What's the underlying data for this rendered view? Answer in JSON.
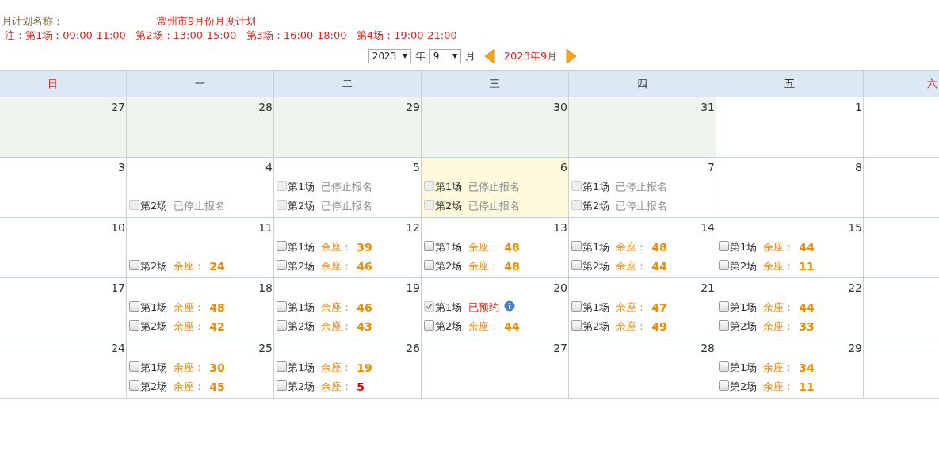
{
  "plan": {
    "label": "月计划名称：",
    "name": "常州市9月份月度计划"
  },
  "note": "注：第1场：09:00-11:00   第2场：13:00-15:00   第3场：16:00-18:00   第4场：19:00-21:00",
  "nav": {
    "year": "2023",
    "year_unit": "年",
    "month": "9",
    "month_unit": "月",
    "current": "2023年9月"
  },
  "weekdays": [
    {
      "label": "日",
      "weekend": true
    },
    {
      "label": "一",
      "weekend": false
    },
    {
      "label": "二",
      "weekend": false
    },
    {
      "label": "三",
      "weekend": false
    },
    {
      "label": "四",
      "weekend": false
    },
    {
      "label": "五",
      "weekend": false
    },
    {
      "label": "六",
      "weekend": true
    }
  ],
  "weeks": [
    [
      {
        "day": "27",
        "kind": "other"
      },
      {
        "day": "28",
        "kind": "other"
      },
      {
        "day": "29",
        "kind": "other"
      },
      {
        "day": "30",
        "kind": "other"
      },
      {
        "day": "31",
        "kind": "other"
      },
      {
        "day": "1",
        "kind": "normal"
      }
    ],
    [
      {
        "day": "3",
        "kind": "normal"
      },
      {
        "day": "4",
        "kind": "normal",
        "sessions": [
          {
            "label": "第2场",
            "kind": "closed",
            "status": "已停止报名",
            "checked": false,
            "disabled": true
          }
        ]
      },
      {
        "day": "5",
        "kind": "normal",
        "sessions": [
          {
            "label": "第1场",
            "kind": "closed",
            "status": "已停止报名",
            "checked": false,
            "disabled": true
          },
          {
            "label": "第2场",
            "kind": "closed",
            "status": "已停止报名",
            "checked": false,
            "disabled": true
          }
        ]
      },
      {
        "day": "6",
        "kind": "today",
        "sessions": [
          {
            "label": "第1场",
            "kind": "closed",
            "status": "已停止报名",
            "checked": false,
            "disabled": true
          },
          {
            "label": "第2场",
            "kind": "closed",
            "status": "已停止报名",
            "checked": false,
            "disabled": true
          }
        ]
      },
      {
        "day": "7",
        "kind": "normal",
        "sessions": [
          {
            "label": "第1场",
            "kind": "closed",
            "status": "已停止报名",
            "checked": false,
            "disabled": true
          },
          {
            "label": "第2场",
            "kind": "closed",
            "status": "已停止报名",
            "checked": false,
            "disabled": true
          }
        ]
      },
      {
        "day": "8",
        "kind": "normal"
      }
    ],
    [
      {
        "day": "10",
        "kind": "normal"
      },
      {
        "day": "11",
        "kind": "normal",
        "sessions": [
          {
            "label": "第2场",
            "kind": "seats",
            "status": "余座：",
            "count": "24",
            "low": false,
            "checked": false,
            "disabled": false
          }
        ]
      },
      {
        "day": "12",
        "kind": "normal",
        "sessions": [
          {
            "label": "第1场",
            "kind": "seats",
            "status": "余座：",
            "count": "39",
            "low": false,
            "checked": false,
            "disabled": false
          },
          {
            "label": "第2场",
            "kind": "seats",
            "status": "余座：",
            "count": "46",
            "low": false,
            "checked": false,
            "disabled": false
          }
        ]
      },
      {
        "day": "13",
        "kind": "normal",
        "sessions": [
          {
            "label": "第1场",
            "kind": "seats",
            "status": "余座：",
            "count": "48",
            "low": false,
            "checked": false,
            "disabled": false
          },
          {
            "label": "第2场",
            "kind": "seats",
            "status": "余座：",
            "count": "48",
            "low": false,
            "checked": false,
            "disabled": false
          }
        ]
      },
      {
        "day": "14",
        "kind": "normal",
        "sessions": [
          {
            "label": "第1场",
            "kind": "seats",
            "status": "余座：",
            "count": "48",
            "low": false,
            "checked": false,
            "disabled": false
          },
          {
            "label": "第2场",
            "kind": "seats",
            "status": "余座：",
            "count": "44",
            "low": false,
            "checked": false,
            "disabled": false
          }
        ]
      },
      {
        "day": "15",
        "kind": "normal",
        "sessions": [
          {
            "label": "第1场",
            "kind": "seats",
            "status": "余座：",
            "count": "44",
            "low": false,
            "checked": false,
            "disabled": false
          },
          {
            "label": "第2场",
            "kind": "seats",
            "status": "余座：",
            "count": "11",
            "low": false,
            "checked": false,
            "disabled": false
          }
        ]
      }
    ],
    [
      {
        "day": "17",
        "kind": "normal"
      },
      {
        "day": "18",
        "kind": "normal",
        "sessions": [
          {
            "label": "第1场",
            "kind": "seats",
            "status": "余座：",
            "count": "48",
            "low": false,
            "checked": false,
            "disabled": false
          },
          {
            "label": "第2场",
            "kind": "seats",
            "status": "余座：",
            "count": "42",
            "low": false,
            "checked": false,
            "disabled": false
          }
        ]
      },
      {
        "day": "19",
        "kind": "normal",
        "sessions": [
          {
            "label": "第1场",
            "kind": "seats",
            "status": "余座：",
            "count": "46",
            "low": false,
            "checked": false,
            "disabled": false
          },
          {
            "label": "第2场",
            "kind": "seats",
            "status": "余座：",
            "count": "43",
            "low": false,
            "checked": false,
            "disabled": false
          }
        ]
      },
      {
        "day": "20",
        "kind": "normal",
        "sessions": [
          {
            "label": "第1场",
            "kind": "booked",
            "status": "已预约",
            "checked": true,
            "disabled": true
          },
          {
            "label": "第2场",
            "kind": "seats",
            "status": "余座：",
            "count": "44",
            "low": false,
            "checked": false,
            "disabled": false
          }
        ]
      },
      {
        "day": "21",
        "kind": "normal",
        "sessions": [
          {
            "label": "第1场",
            "kind": "seats",
            "status": "余座：",
            "count": "47",
            "low": false,
            "checked": false,
            "disabled": false
          },
          {
            "label": "第2场",
            "kind": "seats",
            "status": "余座：",
            "count": "49",
            "low": false,
            "checked": false,
            "disabled": false
          }
        ]
      },
      {
        "day": "22",
        "kind": "normal",
        "sessions": [
          {
            "label": "第1场",
            "kind": "seats",
            "status": "余座：",
            "count": "44",
            "low": false,
            "checked": false,
            "disabled": false
          },
          {
            "label": "第2场",
            "kind": "seats",
            "status": "余座：",
            "count": "33",
            "low": false,
            "checked": false,
            "disabled": false
          }
        ]
      }
    ],
    [
      {
        "day": "24",
        "kind": "normal"
      },
      {
        "day": "25",
        "kind": "normal",
        "sessions": [
          {
            "label": "第1场",
            "kind": "seats",
            "status": "余座：",
            "count": "30",
            "low": false,
            "checked": false,
            "disabled": false
          },
          {
            "label": "第2场",
            "kind": "seats",
            "status": "余座：",
            "count": "45",
            "low": false,
            "checked": false,
            "disabled": false
          }
        ]
      },
      {
        "day": "26",
        "kind": "normal",
        "sessions": [
          {
            "label": "第1场",
            "kind": "seats",
            "status": "余座：",
            "count": "19",
            "low": false,
            "checked": false,
            "disabled": false
          },
          {
            "label": "第2场",
            "kind": "seats",
            "status": "余座：",
            "count": "5",
            "low": true,
            "checked": false,
            "disabled": false
          }
        ]
      },
      {
        "day": "27",
        "kind": "normal"
      },
      {
        "day": "28",
        "kind": "normal"
      },
      {
        "day": "29",
        "kind": "normal",
        "sessions": [
          {
            "label": "第1场",
            "kind": "seats",
            "status": "余座：",
            "count": "34",
            "low": false,
            "checked": false,
            "disabled": false
          },
          {
            "label": "第2场",
            "kind": "seats",
            "status": "余座：",
            "count": "11",
            "low": false,
            "checked": false,
            "disabled": false
          }
        ]
      }
    ]
  ]
}
